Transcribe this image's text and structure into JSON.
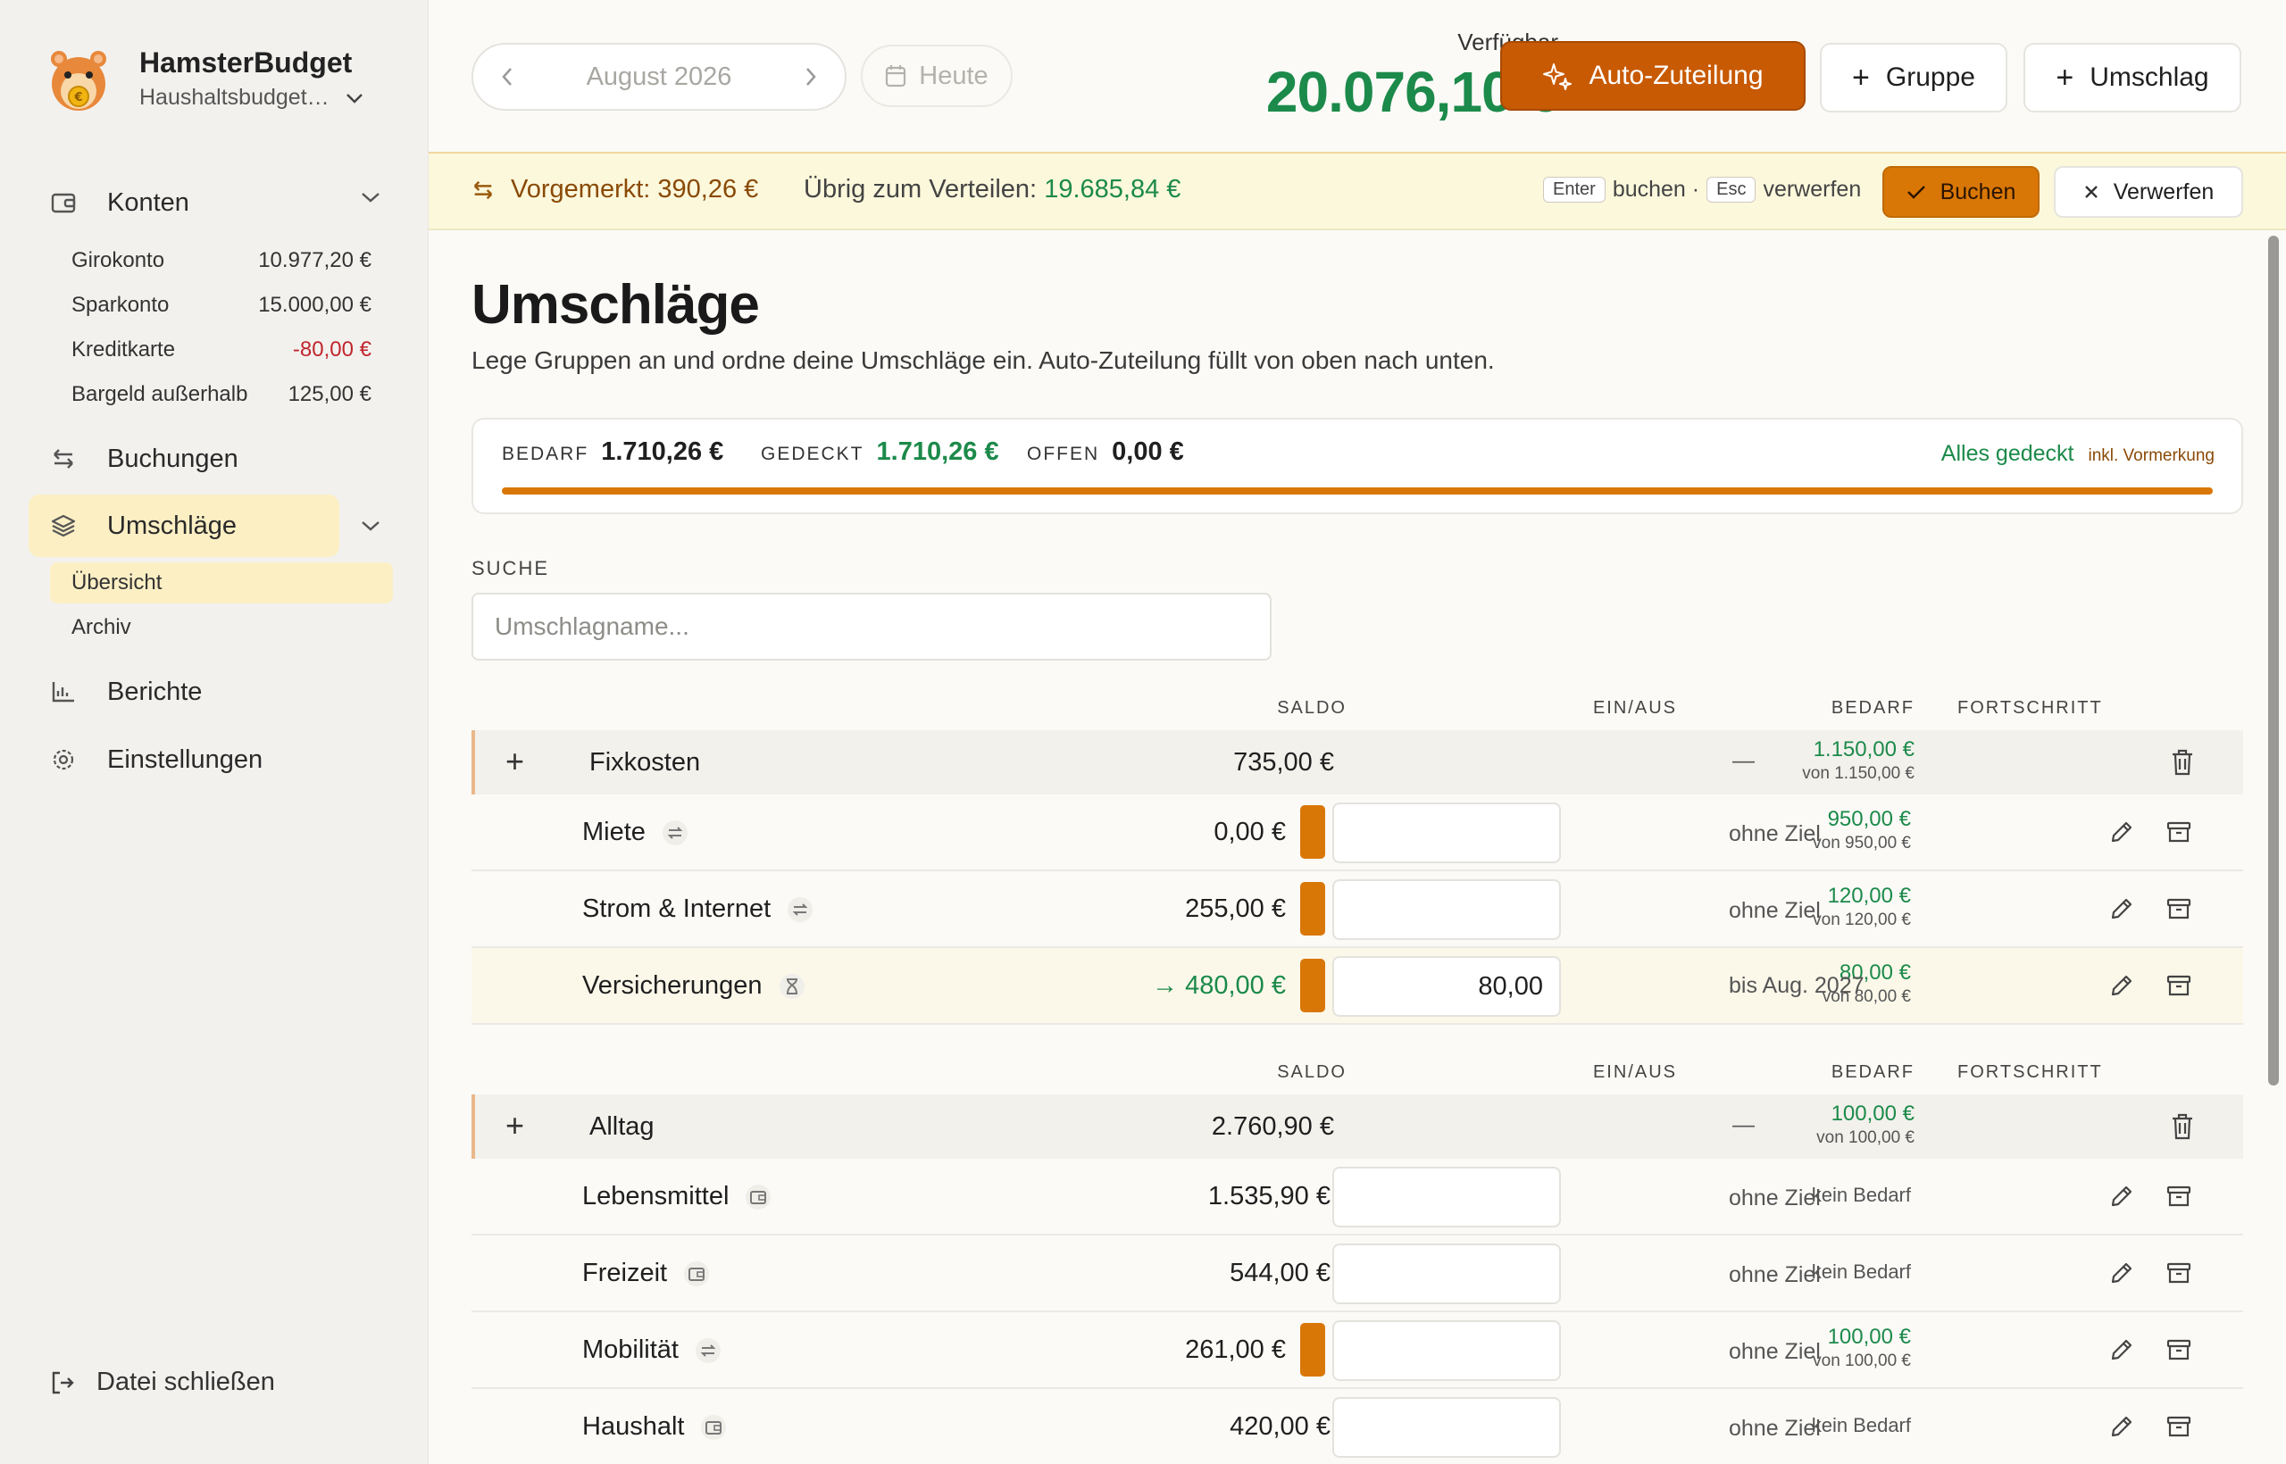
{
  "sidebar": {
    "brand_name": "HamsterBudget",
    "brand_sub": "Haushaltsbudget…",
    "konten_label": "Konten",
    "accounts": [
      {
        "name": "Girokonto",
        "amount": "10.977,20 €"
      },
      {
        "name": "Sparkonto",
        "amount": "15.000,00 €"
      },
      {
        "name": "Kreditkarte",
        "amount": "-80,00 €"
      },
      {
        "name": "Bargeld außerhalb",
        "amount": "125,00 €"
      }
    ],
    "buchungen": "Buchungen",
    "umschlaege": "Umschläge",
    "uebersicht": "Übersicht",
    "archiv": "Archiv",
    "berichte": "Berichte",
    "einstellungen": "Einstellungen",
    "close_file": "Datei schließen"
  },
  "topbar": {
    "month": "August 2026",
    "today": "Heute",
    "available_label": "Verfügbar",
    "available_amount": "20.076,10 €",
    "auto_label": "Auto-Zuteilung",
    "group_label": "Gruppe",
    "envelope_label": "Umschlag"
  },
  "pending": {
    "label": "Vorgemerkt: 390,26 €",
    "rest_label": "Übrig zum Verteilen:",
    "rest_value": "19.685,84 €",
    "key_enter": "Enter",
    "hint_book": "buchen ·",
    "key_esc": "Esc",
    "hint_discard": "verwerfen",
    "book_btn": "Buchen",
    "discard_btn": "Verwerfen"
  },
  "page": {
    "title": "Umschläge",
    "subtitle": "Lege Gruppen an und ordne deine Umschläge ein. Auto-Zuteilung füllt von oben nach unten."
  },
  "summary": {
    "need_label": "BEDARF",
    "need_value": "1.710,26 €",
    "covered_label": "GEDECKT",
    "covered_value": "1.710,26 €",
    "open_label": "OFFEN",
    "open_value": "0,00 €",
    "status": "Alles gedeckt",
    "status_note": "inkl. Vormerkung",
    "progress": 1.0
  },
  "search": {
    "label": "SUCHE",
    "placeholder": "Umschlagname..."
  },
  "columns": {
    "saldo": "SALDO",
    "inout": "EIN/AUS",
    "need": "BEDARF",
    "progress": "FORTSCHRITT"
  },
  "groups": [
    {
      "name": "Fixkosten",
      "saldo": "735,00 €",
      "need": "1.150,00 €",
      "need_of": "von 1.150,00 €",
      "progress": "—",
      "envelopes": [
        {
          "name": "Miete",
          "icon": "repeat-icon",
          "saldo": "0,00 €",
          "inout": "",
          "need": "950,00 €",
          "need_of": "von 950,00 €",
          "progress": "ohne Ziel"
        },
        {
          "name": "Strom & Internet",
          "icon": "repeat-icon",
          "saldo": "255,00 €",
          "inout": "",
          "need": "120,00 €",
          "need_of": "von 120,00 €",
          "progress": "ohne Ziel"
        },
        {
          "name": "Versicherungen",
          "icon": "hourglass-icon",
          "saldo": "→ 480,00 €",
          "inout": "80,00",
          "need": "80,00 €",
          "need_of": "von 80,00 €",
          "progress": "bis Aug. 2027"
        }
      ]
    },
    {
      "name": "Alltag",
      "saldo": "2.760,90 €",
      "need": "100,00 €",
      "need_of": "von 100,00 €",
      "progress": "—",
      "envelopes": [
        {
          "name": "Lebensmittel",
          "icon": "wallet-icon",
          "saldo": "1.535,90 €",
          "inout": "",
          "need": "kein Bedarf",
          "need_of": "",
          "progress": "ohne Ziel"
        },
        {
          "name": "Freizeit",
          "icon": "wallet-icon",
          "saldo": "544,00 €",
          "inout": "",
          "need": "kein Bedarf",
          "need_of": "",
          "progress": "ohne Ziel"
        },
        {
          "name": "Mobilität",
          "icon": "repeat-icon",
          "saldo": "261,00 €",
          "inout": "",
          "need": "100,00 €",
          "need_of": "von 100,00 €",
          "progress": "ohne Ziel"
        },
        {
          "name": "Haushalt",
          "icon": "wallet-icon",
          "saldo": "420,00 €",
          "inout": "",
          "need": "kein Bedarf",
          "need_of": "",
          "progress": "ohne Ziel"
        }
      ]
    }
  ],
  "colors": {
    "accent": "#c85a04",
    "green": "#1c8a4a",
    "negative": "#c0262d",
    "highlight": "#fcefc4"
  }
}
